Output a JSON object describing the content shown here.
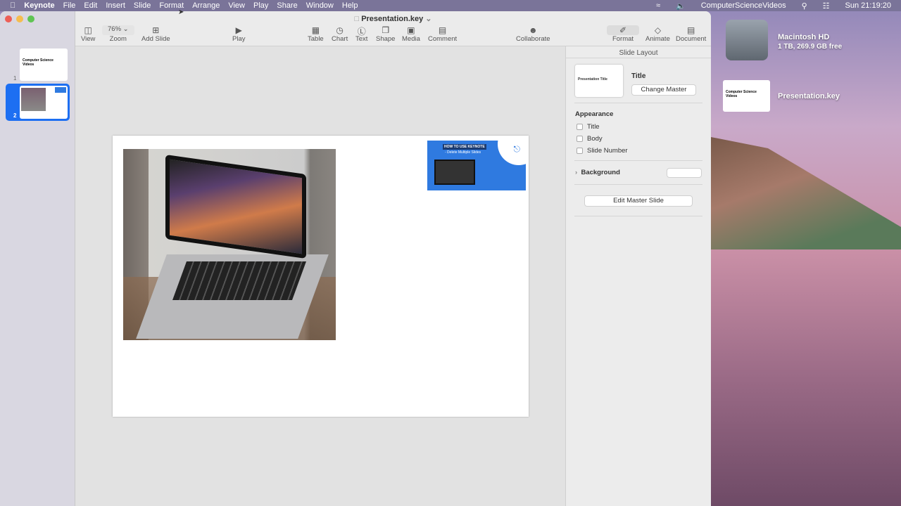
{
  "menubar": {
    "app": "Keynote",
    "items": [
      "File",
      "Edit",
      "Insert",
      "Slide",
      "Format",
      "Arrange",
      "View",
      "Play",
      "Share",
      "Window",
      "Help"
    ],
    "user": "ComputerScienceVideos",
    "clock": "Sun  21:19:20"
  },
  "window": {
    "title": "Presentation.key"
  },
  "toolbar": {
    "view": "View",
    "zoom_value": "76%",
    "zoom": "Zoom",
    "add_slide": "Add Slide",
    "play": "Play",
    "table": "Table",
    "chart": "Chart",
    "text": "Text",
    "shape": "Shape",
    "media": "Media",
    "comment": "Comment",
    "collaborate": "Collaborate",
    "format": "Format",
    "animate": "Animate",
    "document": "Document"
  },
  "slides": [
    {
      "number": "1",
      "title": "Computer Science Videos"
    },
    {
      "number": "2",
      "selected": true
    }
  ],
  "slide_content": {
    "thumbnail_title": "HOW TO USE KEYNOTE",
    "thumbnail_subtitle": "- Delete Multiple Slides"
  },
  "inspector": {
    "header": "Slide Layout",
    "layout_name": "Title",
    "layout_thumb_title": "Presentation Title",
    "change_master": "Change Master",
    "appearance": "Appearance",
    "checkboxes": [
      "Title",
      "Body",
      "Slide Number"
    ],
    "background": "Background",
    "edit_master": "Edit Master Slide"
  },
  "desktop": {
    "disk_name": "Macintosh HD",
    "disk_info": "1 TB, 269.9 GB free",
    "file_name": "Presentation.key",
    "file_thumb_title": "Computer Science Videos"
  }
}
